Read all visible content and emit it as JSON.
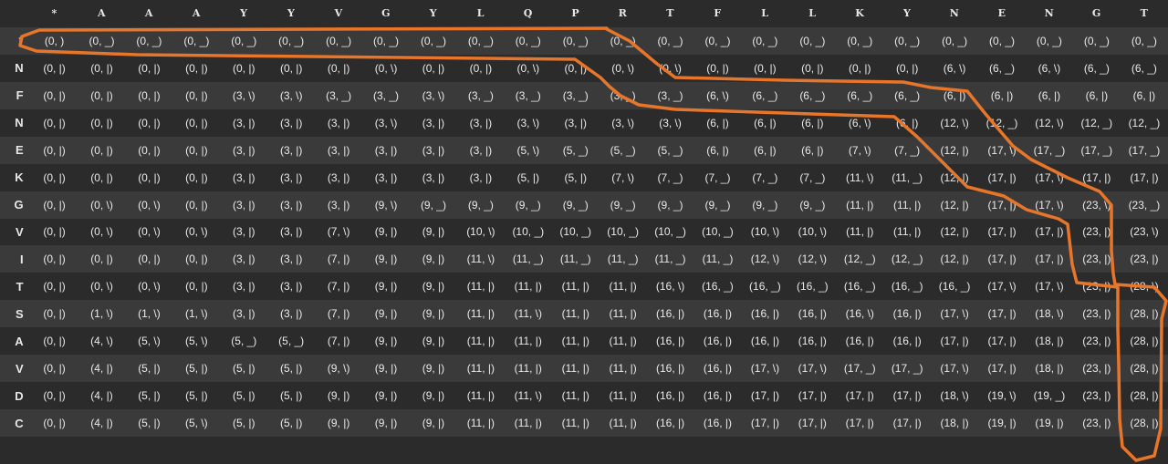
{
  "columns": [
    "*",
    "A",
    "A",
    "A",
    "Y",
    "Y",
    "V",
    "G",
    "Y",
    "L",
    "Q",
    "P",
    "R",
    "T",
    "F",
    "L",
    "L",
    "K",
    "Y",
    "N",
    "E",
    "N",
    "G",
    "T"
  ],
  "rows": [
    {
      "label": "*",
      "cells": [
        "(0, )",
        "(0, _)",
        "(0, _)",
        "(0, _)",
        "(0, _)",
        "(0, _)",
        "(0, _)",
        "(0, _)",
        "(0, _)",
        "(0, _)",
        "(0, _)",
        "(0, _)",
        "(0, _)",
        "(0, _)",
        "(0, _)",
        "(0, _)",
        "(0, _)",
        "(0, _)",
        "(0, _)",
        "(0, _)",
        "(0, _)",
        "(0, _)",
        "(0, _)",
        "(0, _)"
      ]
    },
    {
      "label": "N",
      "cells": [
        "(0, |)",
        "(0, |)",
        "(0, |)",
        "(0, |)",
        "(0, |)",
        "(0, |)",
        "(0, |)",
        "(0, \\)",
        "(0, |)",
        "(0, |)",
        "(0, \\)",
        "(0, |)",
        "(0, \\)",
        "(0, \\)",
        "(0, |)",
        "(0, |)",
        "(0, |)",
        "(0, |)",
        "(0, |)",
        "(6, \\)",
        "(6, _)",
        "(6, \\)",
        "(6, _)",
        "(6, _)"
      ]
    },
    {
      "label": "F",
      "cells": [
        "(0, |)",
        "(0, |)",
        "(0, |)",
        "(0, |)",
        "(3, \\)",
        "(3, \\)",
        "(3, _)",
        "(3, _)",
        "(3, \\)",
        "(3, _)",
        "(3, _)",
        "(3, _)",
        "(3, _)",
        "(3, _)",
        "(6, \\)",
        "(6, _)",
        "(6, _)",
        "(6, _)",
        "(6, _)",
        "(6, |)",
        "(6, |)",
        "(6, |)",
        "(6, |)",
        "(6, |)"
      ]
    },
    {
      "label": "N",
      "cells": [
        "(0, |)",
        "(0, |)",
        "(0, |)",
        "(0, |)",
        "(3, |)",
        "(3, |)",
        "(3, |)",
        "(3, \\)",
        "(3, |)",
        "(3, |)",
        "(3, \\)",
        "(3, |)",
        "(3, \\)",
        "(3, \\)",
        "(6, |)",
        "(6, |)",
        "(6, |)",
        "(6, \\)",
        "(6, |)",
        "(12, \\)",
        "(12, _)",
        "(12, \\)",
        "(12, _)",
        "(12, _)"
      ]
    },
    {
      "label": "E",
      "cells": [
        "(0, |)",
        "(0, |)",
        "(0, |)",
        "(0, |)",
        "(3, |)",
        "(3, |)",
        "(3, |)",
        "(3, |)",
        "(3, |)",
        "(3, |)",
        "(5, \\)",
        "(5, _)",
        "(5, _)",
        "(5, _)",
        "(6, |)",
        "(6, |)",
        "(6, |)",
        "(7, \\)",
        "(7, _)",
        "(12, |)",
        "(17, \\)",
        "(17, _)",
        "(17, _)",
        "(17, _)"
      ]
    },
    {
      "label": "K",
      "cells": [
        "(0, |)",
        "(0, |)",
        "(0, |)",
        "(0, |)",
        "(3, |)",
        "(3, |)",
        "(3, |)",
        "(3, |)",
        "(3, |)",
        "(3, |)",
        "(5, |)",
        "(5, |)",
        "(7, \\)",
        "(7, _)",
        "(7, _)",
        "(7, _)",
        "(7, _)",
        "(11, \\)",
        "(11, _)",
        "(12, |)",
        "(17, |)",
        "(17, \\)",
        "(17, |)",
        "(17, |)"
      ]
    },
    {
      "label": "G",
      "cells": [
        "(0, |)",
        "(0, \\)",
        "(0, \\)",
        "(0, |)",
        "(3, |)",
        "(3, |)",
        "(3, |)",
        "(9, \\)",
        "(9, _)",
        "(9, _)",
        "(9, _)",
        "(9, _)",
        "(9, _)",
        "(9, _)",
        "(9, _)",
        "(9, _)",
        "(9, _)",
        "(11, |)",
        "(11, |)",
        "(12, |)",
        "(17, |)",
        "(17, \\)",
        "(23, \\)",
        "(23, _)"
      ]
    },
    {
      "label": "V",
      "cells": [
        "(0, |)",
        "(0, \\)",
        "(0, \\)",
        "(0, \\)",
        "(3, |)",
        "(3, |)",
        "(7, \\)",
        "(9, |)",
        "(9, |)",
        "(10, \\)",
        "(10, _)",
        "(10, _)",
        "(10, _)",
        "(10, _)",
        "(10, _)",
        "(10, \\)",
        "(10, \\)",
        "(11, |)",
        "(11, |)",
        "(12, |)",
        "(17, |)",
        "(17, |)",
        "(23, |)",
        "(23, \\)"
      ]
    },
    {
      "label": "I",
      "cells": [
        "(0, |)",
        "(0, |)",
        "(0, |)",
        "(0, |)",
        "(3, |)",
        "(3, |)",
        "(7, |)",
        "(9, |)",
        "(9, |)",
        "(11, \\)",
        "(11, _)",
        "(11, _)",
        "(11, _)",
        "(11, _)",
        "(11, _)",
        "(12, \\)",
        "(12, \\)",
        "(12, _)",
        "(12, _)",
        "(12, |)",
        "(17, |)",
        "(17, |)",
        "(23, |)",
        "(23, |)"
      ]
    },
    {
      "label": "T",
      "cells": [
        "(0, |)",
        "(0, \\)",
        "(0, \\)",
        "(0, |)",
        "(3, |)",
        "(3, |)",
        "(7, |)",
        "(9, |)",
        "(9, |)",
        "(11, |)",
        "(11, |)",
        "(11, |)",
        "(11, |)",
        "(16, \\)",
        "(16, _)",
        "(16, _)",
        "(16, _)",
        "(16, _)",
        "(16, _)",
        "(16, _)",
        "(17, \\)",
        "(17, \\)",
        "(23, |)",
        "(28, \\)"
      ]
    },
    {
      "label": "S",
      "cells": [
        "(0, |)",
        "(1, \\)",
        "(1, \\)",
        "(1, \\)",
        "(3, |)",
        "(3, |)",
        "(7, |)",
        "(9, |)",
        "(9, |)",
        "(11, |)",
        "(11, \\)",
        "(11, |)",
        "(11, |)",
        "(16, |)",
        "(16, |)",
        "(16, |)",
        "(16, |)",
        "(16, \\)",
        "(16, |)",
        "(17, \\)",
        "(17, |)",
        "(18, \\)",
        "(23, |)",
        "(28, |)"
      ]
    },
    {
      "label": "A",
      "cells": [
        "(0, |)",
        "(4, \\)",
        "(5, \\)",
        "(5, \\)",
        "(5, _)",
        "(5, _)",
        "(7, |)",
        "(9, |)",
        "(9, |)",
        "(11, |)",
        "(11, |)",
        "(11, |)",
        "(11, |)",
        "(16, |)",
        "(16, |)",
        "(16, |)",
        "(16, |)",
        "(16, |)",
        "(16, |)",
        "(17, |)",
        "(17, |)",
        "(18, |)",
        "(23, |)",
        "(28, |)"
      ]
    },
    {
      "label": "V",
      "cells": [
        "(0, |)",
        "(4, |)",
        "(5, |)",
        "(5, |)",
        "(5, |)",
        "(5, |)",
        "(9, \\)",
        "(9, |)",
        "(9, |)",
        "(11, |)",
        "(11, |)",
        "(11, |)",
        "(11, |)",
        "(16, |)",
        "(16, |)",
        "(17, \\)",
        "(17, \\)",
        "(17, _)",
        "(17, _)",
        "(17, \\)",
        "(17, |)",
        "(18, |)",
        "(23, |)",
        "(28, |)"
      ]
    },
    {
      "label": "D",
      "cells": [
        "(0, |)",
        "(4, |)",
        "(5, |)",
        "(5, |)",
        "(5, |)",
        "(5, |)",
        "(9, |)",
        "(9, |)",
        "(9, |)",
        "(11, |)",
        "(11, \\)",
        "(11, |)",
        "(11, |)",
        "(16, |)",
        "(16, |)",
        "(17, |)",
        "(17, |)",
        "(17, |)",
        "(17, |)",
        "(18, \\)",
        "(19, \\)",
        "(19, _)",
        "(23, |)",
        "(28, |)"
      ]
    },
    {
      "label": "C",
      "cells": [
        "(0, |)",
        "(4, |)",
        "(5, |)",
        "(5, \\)",
        "(5, |)",
        "(5, |)",
        "(9, |)",
        "(9, |)",
        "(9, |)",
        "(11, |)",
        "(11, |)",
        "(11, |)",
        "(11, |)",
        "(16, |)",
        "(16, |)",
        "(17, |)",
        "(17, |)",
        "(17, |)",
        "(17, |)",
        "(18, |)",
        "(19, |)",
        "(19, |)",
        "(23, |)",
        "(28, |)"
      ]
    }
  ],
  "path_color": "#e8762a"
}
